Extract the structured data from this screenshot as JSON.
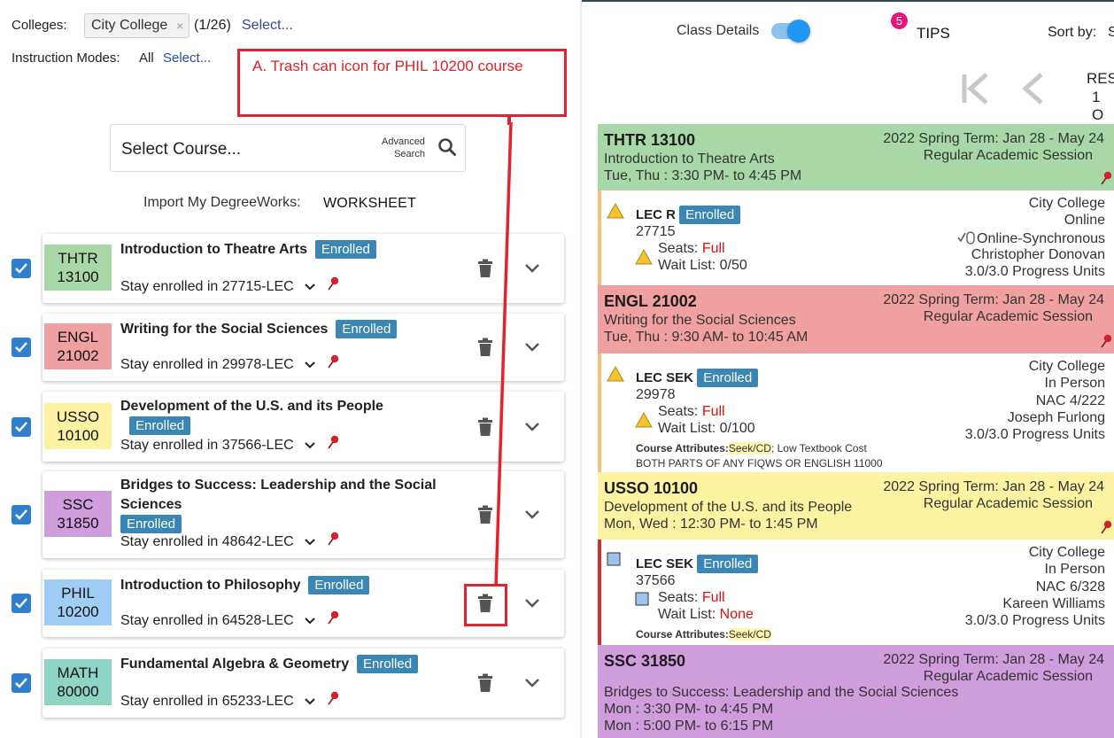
{
  "filters": {
    "colleges_label": "Colleges:",
    "college_chip": "City College",
    "chip_remove": "×",
    "colleges_count": "(1/26)",
    "colleges_select": "Select...",
    "modes_label": "Instruction Modes:",
    "modes_value": "All",
    "modes_select": "Select..."
  },
  "search": {
    "placeholder": "Select Course...",
    "advanced_line1": "Advanced",
    "advanced_line2": "Search"
  },
  "import": {
    "label": "Import My DegreeWorks:",
    "worksheet": "WORKSHEET"
  },
  "annotation": {
    "text": "A. Trash can icon for PHIL 10200 course"
  },
  "courses": [
    {
      "subject": "THTR",
      "number": "13100",
      "title": "Introduction to Theatre Arts",
      "title2": "",
      "status": "Enrolled",
      "stay": "Stay enrolled in 27715-LEC",
      "color": "#a8d8a8",
      "checked": true
    },
    {
      "subject": "ENGL",
      "number": "21002",
      "title": "Writing for the Social Sciences",
      "title2": "",
      "status": "Enrolled",
      "stay": "Stay enrolled in 29978-LEC",
      "color": "#f0a0a0",
      "checked": true
    },
    {
      "subject": "USSO",
      "number": "10100",
      "title": "Development of the U.S. and its People",
      "title2": "",
      "status": "Enrolled",
      "stay": "Stay enrolled in 37566-LEC",
      "color": "#fbf3a2",
      "checked": true
    },
    {
      "subject": "SSC",
      "number": "31850",
      "title": "Bridges to Success: Leadership and the Social",
      "title2": "Sciences",
      "status": "Enrolled",
      "stay": "Stay enrolled in 48642-LEC",
      "color": "#cf9cdc",
      "checked": true
    },
    {
      "subject": "PHIL",
      "number": "10200",
      "title": "Introduction to Philosophy",
      "title2": "",
      "status": "Enrolled",
      "stay": "Stay enrolled in 64528-LEC",
      "color": "#9fcdf5",
      "checked": true
    },
    {
      "subject": "MATH",
      "number": "80000",
      "title": "Fundamental Algebra & Geometry",
      "title2": "",
      "status": "Enrolled",
      "stay": "Stay enrolled in 65233-LEC",
      "color": "#8fd3c4",
      "checked": true
    }
  ],
  "toolbar": {
    "class_details": "Class Details",
    "tips_count": "5",
    "tips": "TIPS",
    "sort_by": "Sort by:",
    "sort_value_partial": "S",
    "results_partial": "RES",
    "results_num_partial": "1 O"
  },
  "schedule": [
    {
      "code": "THTR 13100",
      "name": "Introduction to Theatre Arts",
      "times": [
        "Tue, Thu : 3:30 PM- to 4:45 PM"
      ],
      "term": "2022 Spring Term: Jan 28 - May 24",
      "session": "Regular Academic Session",
      "head_color": "#a8d8a8",
      "accent": "#f5c07a",
      "component": "LEC R",
      "status": "Enrolled",
      "class_num": "27715",
      "seats_label": "Seats:",
      "seats_value": "Full",
      "wait_label": "Wait List:",
      "wait_value": "0/50",
      "college": "City College",
      "mode": "Online",
      "room": "Online-Synchronous",
      "instructor": "Christopher Donovan",
      "units": "3.0/3.0 Progress Units",
      "attr_label": "",
      "attr_hl": "",
      "attr_rest": "",
      "attr_line2": ""
    },
    {
      "code": "ENGL 21002",
      "name": "Writing for the Social Sciences",
      "times": [
        "Tue, Thu : 9:30 AM- to 10:45 AM"
      ],
      "term": "2022 Spring Term: Jan 28 - May 24",
      "session": "Regular Academic Session",
      "head_color": "#f0a0a0",
      "accent": "#f5c07a",
      "component": "LEC SEK",
      "status": "Enrolled",
      "class_num": "29978",
      "seats_label": "Seats:",
      "seats_value": "Full",
      "wait_label": "Wait List:",
      "wait_value": "0/100",
      "college": "City College",
      "mode": "In Person",
      "room": "NAC 4/222",
      "instructor": "Joseph Furlong",
      "units": "3.0/3.0 Progress Units",
      "attr_label": "Course Attributes:",
      "attr_hl": "Seek/CD",
      "attr_rest": "; Low Textbook Cost",
      "attr_line2": "BOTH PARTS OF ANY FIQWS OR ENGLISH 11000"
    },
    {
      "code": "USSO 10100",
      "name": "Development of the U.S. and its People",
      "times": [
        "Mon, Wed : 12:30 PM- to 1:45 PM"
      ],
      "term": "2022 Spring Term: Jan 28 - May 24",
      "session": "Regular Academic Session",
      "head_color": "#fbf3a2",
      "accent": "#d32f2f",
      "component": "LEC SEK",
      "status": "Enrolled",
      "class_num": "37566",
      "seats_label": "Seats:",
      "seats_value": "Full",
      "wait_label": "Wait List:",
      "wait_value": "None",
      "college": "City College",
      "mode": "In Person",
      "room": "NAC 6/328",
      "instructor": "Kareen Williams",
      "units": "3.0/3.0 Progress Units",
      "attr_label": "Course Attributes:",
      "attr_hl": "Seek/CD",
      "attr_rest": "",
      "attr_line2": ""
    },
    {
      "code": "SSC 31850",
      "name": "Bridges to Success: Leadership and the Social Sciences",
      "times": [
        "Mon : 3:30 PM- to 4:45 PM",
        "Mon : 5:00 PM- to 6:15 PM"
      ],
      "term": "2022 Spring Term: Jan 28 - May 24",
      "session": "Regular Academic Session",
      "head_color": "#cf9cdc",
      "accent": "",
      "component": "",
      "status": "",
      "class_num": "",
      "seats_label": "",
      "seats_value": "",
      "wait_label": "",
      "wait_value": "",
      "college": "",
      "mode": "",
      "room": "",
      "instructor": "",
      "units": "",
      "attr_label": "",
      "attr_hl": "",
      "attr_rest": "",
      "attr_line2": ""
    }
  ]
}
